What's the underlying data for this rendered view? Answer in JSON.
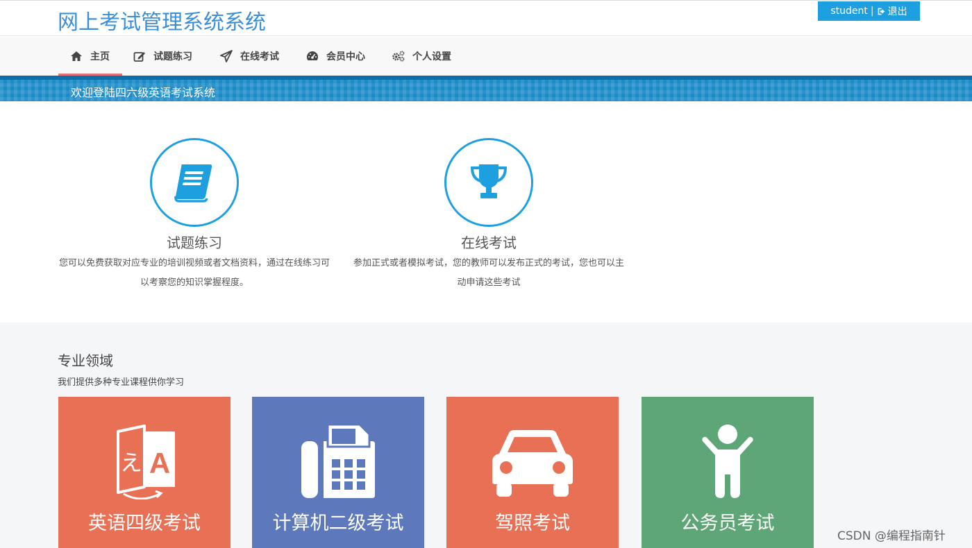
{
  "header": {
    "site_title": "网上考试管理系统系统",
    "user_name": "student",
    "separator": "|",
    "logout_label": "退出"
  },
  "nav": {
    "items": [
      {
        "label": "主页",
        "icon": "home-icon",
        "active": true
      },
      {
        "label": "试题练习",
        "icon": "edit-icon"
      },
      {
        "label": "在线考试",
        "icon": "send-icon"
      },
      {
        "label": "会员中心",
        "icon": "dashboard-icon"
      },
      {
        "label": "个人设置",
        "icon": "gears-icon"
      }
    ]
  },
  "banner": {
    "text": "欢迎登陆四六级英语考试系统"
  },
  "features": [
    {
      "title": "试题练习",
      "desc": "您可以免费获取对应专业的培训视频或者文档资料，通过在线练习可以考察您的知识掌握程度。",
      "icon": "book-icon"
    },
    {
      "title": "在线考试",
      "desc": "参加正式或者模拟考试，您的教师可以发布正式的考试，您也可以主动申请这些考试",
      "icon": "trophy-icon"
    }
  ],
  "section": {
    "title": "专业领域",
    "subtitle": "我们提供多种专业课程供你学习"
  },
  "cards": [
    {
      "label": "英语四级考试",
      "color": "#e87155",
      "icon": "translate-icon"
    },
    {
      "label": "计算机二级考试",
      "color": "#5d79bb",
      "icon": "fax-icon"
    },
    {
      "label": "驾照考试",
      "color": "#e87155",
      "icon": "car-icon"
    },
    {
      "label": "公务员考试",
      "color": "#5ea677",
      "icon": "person-icon"
    }
  ],
  "watermark": "CSDN @编程指南针",
  "colors": {
    "accent": "#1ea0e0",
    "title_blue": "#3b8fd8",
    "nav_active_underline": "#e57373"
  }
}
